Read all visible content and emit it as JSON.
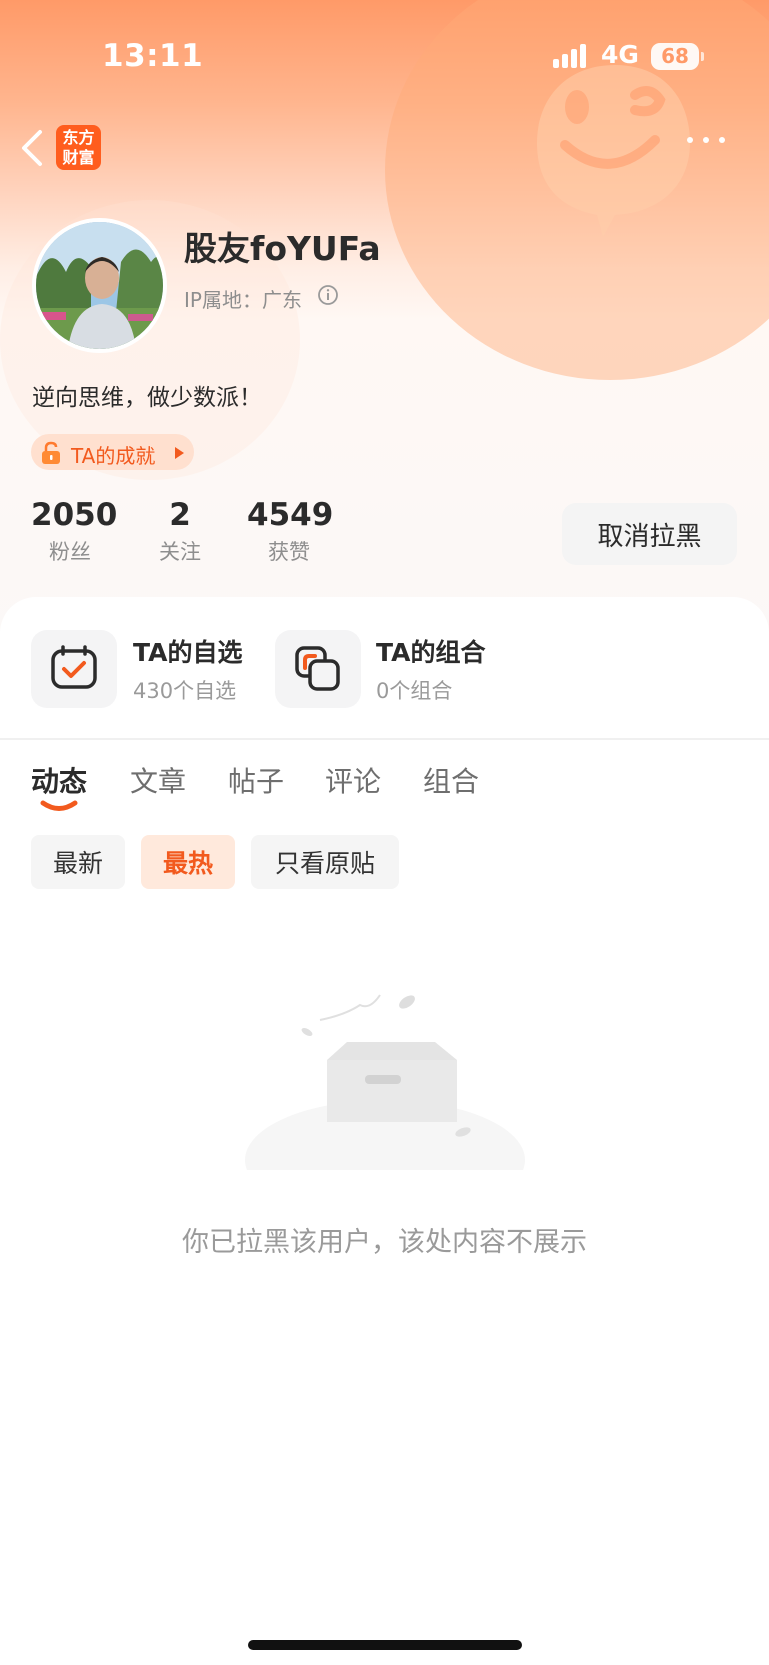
{
  "status_bar": {
    "time": "13:11",
    "network": "4G",
    "battery": "68"
  },
  "nav": {
    "logo_line1": "东方",
    "logo_line2": "财富"
  },
  "profile": {
    "username": "股友foYUFa",
    "ip_location": "IP属地：广东",
    "bio": "逆向思维，做少数派！",
    "achievement_badge": "TA的成就"
  },
  "stats": [
    {
      "value": "2050",
      "label": "粉丝"
    },
    {
      "value": "2",
      "label": "关注"
    },
    {
      "value": "4549",
      "label": "获赞"
    }
  ],
  "unblock_button": "取消拉黑",
  "tiles": [
    {
      "title": "TA的自选",
      "subtitle": "430个自选"
    },
    {
      "title": "TA的组合",
      "subtitle": "0个组合"
    }
  ],
  "tabs": [
    "动态",
    "文章",
    "帖子",
    "评论",
    "组合"
  ],
  "active_tab": "动态",
  "filters": [
    "最新",
    "最热",
    "只看原贴"
  ],
  "active_filter": "最热",
  "empty_message": "你已拉黑该用户，该处内容不展示",
  "colors": {
    "accent": "#f25a1e",
    "header_orange": "#ff9a68",
    "logo_bg": "#ff5d1e"
  },
  "icons": [
    "chevron-left-icon",
    "more-icon",
    "info-icon",
    "lock-icon",
    "watchlist-check-icon",
    "portfolio-icon"
  ]
}
